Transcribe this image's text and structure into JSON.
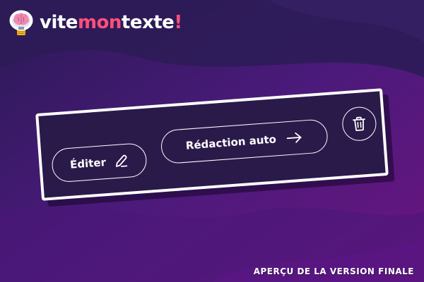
{
  "brand": {
    "part1": "vite",
    "part2": "mon",
    "part3": "texte",
    "part4": "!"
  },
  "toolbar": {
    "edit_label": "Éditer",
    "auto_label": "Rédaction auto",
    "icons": {
      "edit": "pencil-icon",
      "auto": "arrow-right-icon",
      "delete": "trash-icon"
    }
  },
  "caption": "Aperçu de la version finale",
  "colors": {
    "background": "#3a1a6e",
    "toolbar_bg": "#2a1a4a",
    "accent": "#ff4f7b",
    "text": "#ffffff"
  }
}
